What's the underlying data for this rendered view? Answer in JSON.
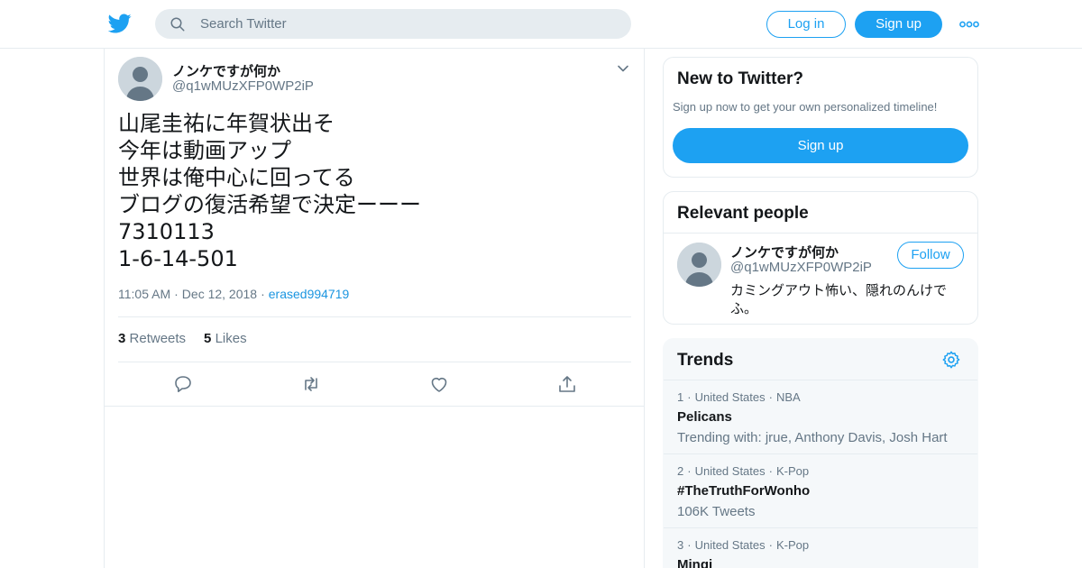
{
  "header": {
    "search_placeholder": "Search Twitter",
    "login_label": "Log in",
    "signup_label": "Sign up",
    "accent_color": "#1da1f2"
  },
  "tweet": {
    "author_name": "ノンケですが何か",
    "author_handle": "@q1wMUzXFP0WP2iP",
    "text_lines": [
      "山尾圭祐に年賀状出そ",
      "今年は動画アップ",
      "世界は俺中心に回ってる",
      "ブログの復活希望で決定ーーー",
      "7310113",
      "1-6-14-501"
    ],
    "time": "11:05 AM",
    "date": "Dec 12, 2018",
    "via": "erased994719",
    "retweets_count": "3",
    "retweets_label": "Retweets",
    "likes_count": "5",
    "likes_label": "Likes"
  },
  "sidebar": {
    "new_to_twitter": {
      "title": "New to Twitter?",
      "subtitle": "Sign up now to get your own personalized timeline!",
      "button_label": "Sign up"
    },
    "relevant_people": {
      "title": "Relevant people",
      "person": {
        "name": "ノンケですが何か",
        "handle": "@q1wMUzXFP0WP2iP",
        "bio": "カミングアウト怖い、隠れのんけでふ。",
        "follow_label": "Follow"
      }
    },
    "trends": {
      "title": "Trends",
      "items": [
        {
          "rank": "1",
          "location": "United States",
          "category": "NBA",
          "name": "Pelicans",
          "meta": "Trending with: jrue, Anthony Davis, Josh Hart"
        },
        {
          "rank": "2",
          "location": "United States",
          "category": "K-Pop",
          "name": "#TheTruthForWonho",
          "meta": "106K Tweets"
        },
        {
          "rank": "3",
          "location": "United States",
          "category": "K-Pop",
          "name": "Mingi",
          "meta": ""
        }
      ]
    }
  }
}
